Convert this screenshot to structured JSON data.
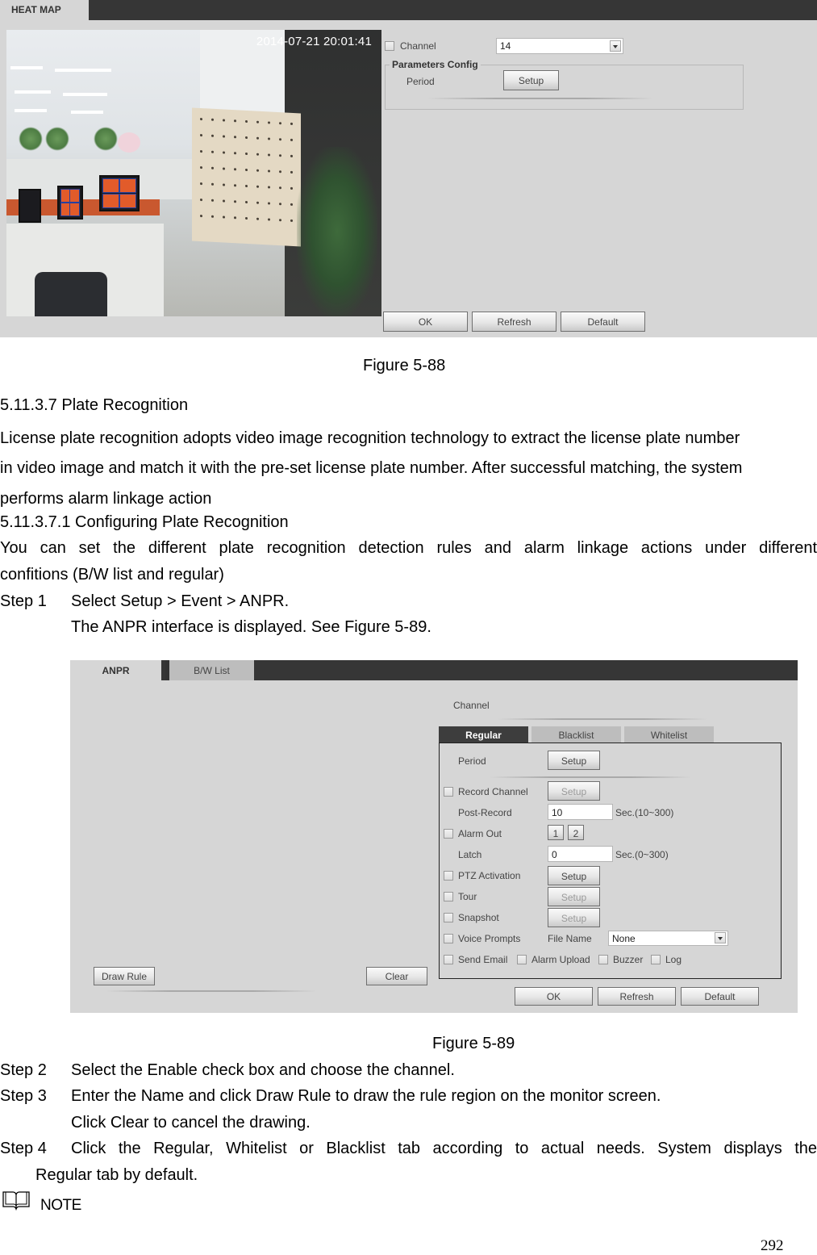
{
  "figure_88": {
    "tab_label": "HEAT MAP",
    "video": {
      "timestamp": "2014-07-21 20:01:41"
    },
    "channel": {
      "label": "Channel",
      "checked": false,
      "selected_value": "14"
    },
    "parameters_config": {
      "legend": "Parameters Config",
      "period_label": "Period",
      "setup_button": "Setup"
    },
    "buttons": {
      "ok": "OK",
      "refresh": "Refresh",
      "default": "Default"
    },
    "caption": "Figure 5-88"
  },
  "section": {
    "heading": "5.11.3.7  Plate Recognition",
    "intro_lines": [
      "License plate recognition adopts video image recognition technology to extract the license plate number",
      "in video image and match it with the pre-set license plate number. After successful matching, the system",
      "performs alarm linkage action"
    ],
    "subheading": "5.11.3.7.1   Configuring Plate Recognition",
    "sub_intro_line1": "You can set the different plate recognition detection rules and alarm linkage actions under different",
    "sub_intro_line2": "confitions (B/W list and regular)",
    "step1_label": "Step 1",
    "step1_text": "Select Setup > Event > ANPR.",
    "step1_result": "The ANPR interface is displayed. See Figure 5-89."
  },
  "figure_89": {
    "tabs": [
      {
        "label": "ANPR",
        "active": true
      },
      {
        "label": "B/W List",
        "active": false
      }
    ],
    "channel_label": "Channel",
    "subtabs": [
      {
        "label": "Regular",
        "active": true
      },
      {
        "label": "Blacklist",
        "active": false
      },
      {
        "label": "Whitelist",
        "active": false
      }
    ],
    "period": {
      "label": "Period",
      "button": "Setup"
    },
    "record_channel": {
      "label": "Record Channel",
      "checked": false,
      "button": "Setup"
    },
    "post_record": {
      "label": "Post-Record",
      "value": "10",
      "unit": "Sec.(10~300)"
    },
    "alarm_out": {
      "label": "Alarm Out",
      "checked": false,
      "outputs": [
        "1",
        "2"
      ]
    },
    "latch": {
      "label": "Latch",
      "value": "0",
      "unit": "Sec.(0~300)"
    },
    "ptz_activation": {
      "label": "PTZ Activation",
      "checked": false,
      "button": "Setup"
    },
    "tour": {
      "label": "Tour",
      "checked": false,
      "button": "Setup"
    },
    "snapshot": {
      "label": "Snapshot",
      "checked": false,
      "button": "Setup"
    },
    "voice_prompts": {
      "label": "Voice Prompts",
      "checked": false,
      "file_name_label": "File Name",
      "file_name_value": "None"
    },
    "send_email": {
      "label": "Send Email",
      "checked": false
    },
    "alarm_upload": {
      "label": "Alarm Upload",
      "checked": false
    },
    "buzzer": {
      "label": "Buzzer",
      "checked": false
    },
    "log": {
      "label": "Log",
      "checked": false
    },
    "draw_rule_button": "Draw Rule",
    "clear_button": "Clear",
    "buttons": {
      "ok": "OK",
      "refresh": "Refresh",
      "default": "Default"
    },
    "caption": "Figure 5-89"
  },
  "steps": {
    "step2_label": "Step 2",
    "step2_text": "Select the Enable check box and choose the channel.",
    "step3_label": "Step 3",
    "step3_text": "Enter the Name and click Draw Rule to draw the rule region on the monitor screen.",
    "step3_result": "Click Clear to cancel the drawing.",
    "step4_label": "Step 4",
    "step4_text": "Click the Regular, Whitelist or Blacklist tab according to actual needs. System displays the",
    "step4_text_cont": "Regular tab by default."
  },
  "note": {
    "icon": "book-icon",
    "label": "NOTE"
  },
  "page_number": "292"
}
